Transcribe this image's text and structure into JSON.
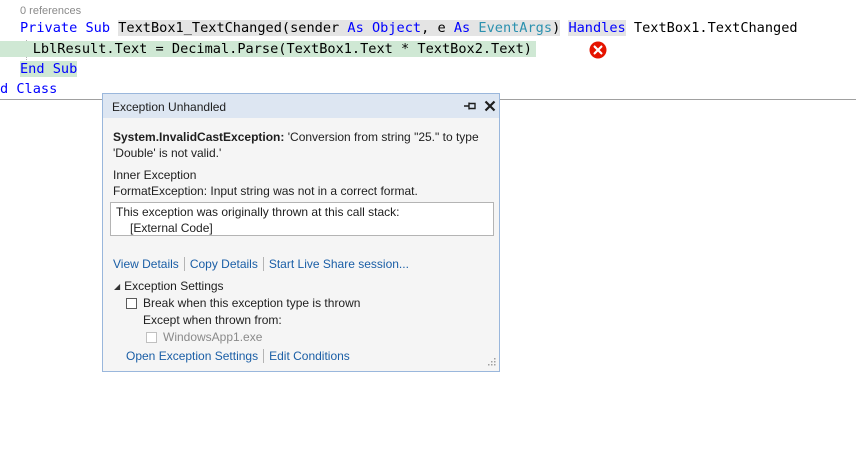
{
  "editor": {
    "codelens": "0 references",
    "line1": {
      "kw_private": "Private",
      "kw_sub": "Sub",
      "method_name": "TextBox1_TextChanged",
      "open_paren": "(",
      "param1": "sender",
      "as1": "As",
      "type1": "Object",
      "comma": ",",
      "param2": "e",
      "as2": "As",
      "type2": "EventArgs",
      "close_paren": ")",
      "kw_handles": "Handles",
      "handles_target": "TextBox1.TextChanged"
    },
    "line2": {
      "statement": "LblResult.Text = Decimal.Parse(TextBox1.Text * TextBox2.Text)"
    },
    "line3": {
      "kw_end": "End",
      "kw_sub": "Sub"
    },
    "line4": {
      "kw_end_fragment": "d",
      "kw_class": "Class"
    },
    "error_icon": "error-circle-x-icon",
    "colors": {
      "keyword": "#0000ff",
      "type": "#2b91af",
      "current_statement_bg": "#cfe8d4",
      "error": "#e51400"
    }
  },
  "exception_popup": {
    "title": "Exception Unhandled",
    "pin_icon": "pin-icon",
    "close_icon": "close-icon",
    "exception_type": "System.InvalidCastException:",
    "exception_message": "'Conversion from string \"25.\" to type 'Double' is not valid.'",
    "inner_exception_label": "Inner Exception",
    "inner_exception_text": "FormatException: Input string was not in a correct format.",
    "call_stack_intro": "This exception was originally thrown at this call stack:",
    "call_stack_frame": "[External Code]",
    "links": [
      "View Details",
      "Copy Details",
      "Start Live Share session..."
    ],
    "settings": {
      "header": "Exception Settings",
      "break_label": "Break when this exception type is thrown",
      "break_checked": false,
      "except_label": "Except when thrown from:",
      "module_label": "WindowsApp1.exe",
      "module_checked": false,
      "links": [
        "Open Exception Settings",
        "Edit Conditions"
      ]
    },
    "colors": {
      "header_bg": "#dde6f2",
      "border": "#9ab7dc",
      "link": "#1a5ea6"
    }
  }
}
